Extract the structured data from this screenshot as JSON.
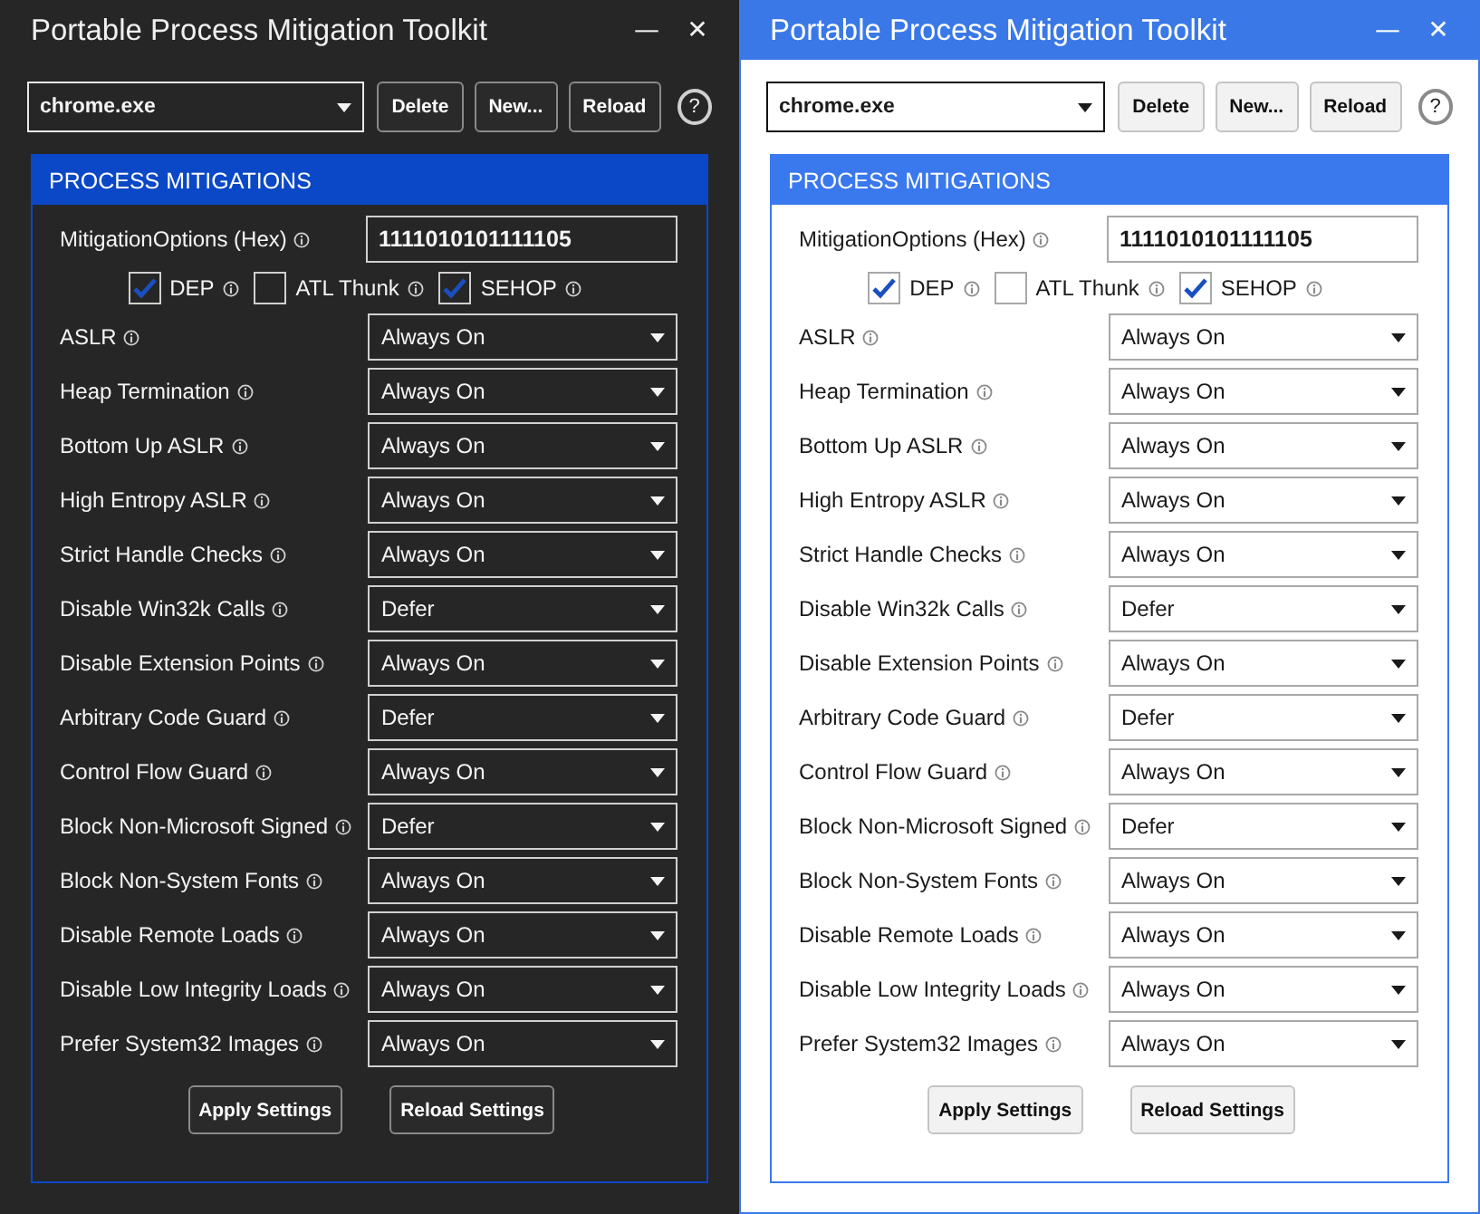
{
  "windows": [
    {
      "kind": "dark",
      "title": "Portable Process Mitigation Toolkit",
      "minimize": "—",
      "close": "✕",
      "process": "chrome.exe",
      "buttons": [
        "Delete",
        "New...",
        "Reload"
      ],
      "help": "?",
      "group_title": "PROCESS MITIGATIONS",
      "hex_label": "MitigationOptions (Hex)",
      "hex_value": "1111010101111105",
      "checkboxes": [
        {
          "label": "DEP",
          "checked": true
        },
        {
          "label": "ATL Thunk",
          "checked": false
        },
        {
          "label": "SEHOP",
          "checked": true
        }
      ],
      "settings": [
        {
          "label": "ASLR",
          "value": "Always On"
        },
        {
          "label": "Heap Termination",
          "value": "Always On"
        },
        {
          "label": "Bottom Up ASLR",
          "value": "Always On"
        },
        {
          "label": "High Entropy ASLR",
          "value": "Always On"
        },
        {
          "label": "Strict Handle Checks",
          "value": "Always On"
        },
        {
          "label": "Disable Win32k Calls",
          "value": "Defer"
        },
        {
          "label": "Disable Extension Points",
          "value": "Always On"
        },
        {
          "label": "Arbitrary Code Guard",
          "value": "Defer"
        },
        {
          "label": "Control Flow Guard",
          "value": "Always On"
        },
        {
          "label": "Block Non-Microsoft Signed",
          "value": "Defer"
        },
        {
          "label": "Block Non-System Fonts",
          "value": "Always On"
        },
        {
          "label": "Disable Remote Loads",
          "value": "Always On"
        },
        {
          "label": "Disable Low Integrity Loads",
          "value": "Always On"
        },
        {
          "label": "Prefer System32 Images",
          "value": "Always On"
        }
      ],
      "footer_buttons": [
        "Apply Settings",
        "Reload Settings"
      ]
    },
    {
      "kind": "light",
      "title": "Portable Process Mitigation Toolkit",
      "minimize": "—",
      "close": "✕",
      "process": "chrome.exe",
      "buttons": [
        "Delete",
        "New...",
        "Reload"
      ],
      "help": "?",
      "group_title": "PROCESS MITIGATIONS",
      "hex_label": "MitigationOptions (Hex)",
      "hex_value": "1111010101111105",
      "checkboxes": [
        {
          "label": "DEP",
          "checked": true
        },
        {
          "label": "ATL Thunk",
          "checked": false
        },
        {
          "label": "SEHOP",
          "checked": true
        }
      ],
      "settings": [
        {
          "label": "ASLR",
          "value": "Always On"
        },
        {
          "label": "Heap Termination",
          "value": "Always On"
        },
        {
          "label": "Bottom Up ASLR",
          "value": "Always On"
        },
        {
          "label": "High Entropy ASLR",
          "value": "Always On"
        },
        {
          "label": "Strict Handle Checks",
          "value": "Always On"
        },
        {
          "label": "Disable Win32k Calls",
          "value": "Defer"
        },
        {
          "label": "Disable Extension Points",
          "value": "Always On"
        },
        {
          "label": "Arbitrary Code Guard",
          "value": "Defer"
        },
        {
          "label": "Control Flow Guard",
          "value": "Always On"
        },
        {
          "label": "Block Non-Microsoft Signed",
          "value": "Defer"
        },
        {
          "label": "Block Non-System Fonts",
          "value": "Always On"
        },
        {
          "label": "Disable Remote Loads",
          "value": "Always On"
        },
        {
          "label": "Disable Low Integrity Loads",
          "value": "Always On"
        },
        {
          "label": "Prefer System32 Images",
          "value": "Always On"
        }
      ],
      "footer_buttons": [
        "Apply Settings",
        "Reload Settings"
      ]
    }
  ]
}
